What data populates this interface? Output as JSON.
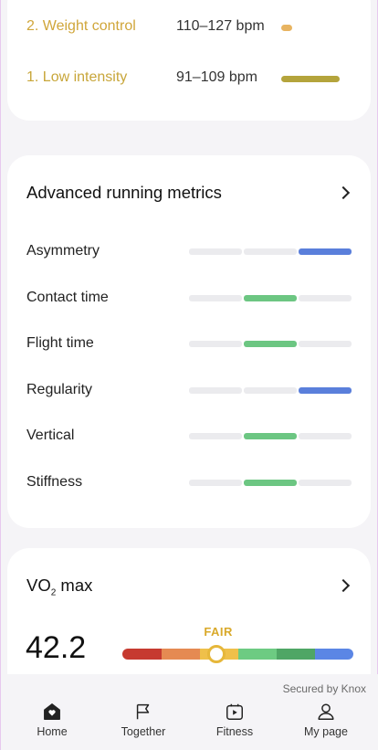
{
  "heart_rate_zones": [
    {
      "label": "2. Weight control",
      "bpm": "110–127 bpm",
      "color": "#d0a63a",
      "bar_color": "#e0b15c",
      "time_fraction": 0.03
    },
    {
      "label": "1. Low intensity",
      "bpm": "91–109 bpm",
      "color": "#c8a63a",
      "bar_color": "#b8a93a",
      "time_fraction": 0.2
    }
  ],
  "advanced_metrics": {
    "title": "Advanced running metrics",
    "items": [
      {
        "label": "Asymmetry",
        "level_segment": 2,
        "color": "#5a7fdb"
      },
      {
        "label": "Contact time",
        "level_segment": 1,
        "color": "#6cc682"
      },
      {
        "label": "Flight time",
        "level_segment": 1,
        "color": "#6cc682"
      },
      {
        "label": "Regularity",
        "level_segment": 2,
        "color": "#5a7fdb"
      },
      {
        "label": "Vertical",
        "level_segment": 1,
        "color": "#6cc682"
      },
      {
        "label": "Stiffness",
        "level_segment": 1,
        "color": "#6cc682"
      }
    ]
  },
  "vo2max": {
    "title_main": "VO",
    "title_sub": "2",
    "title_suffix": " max",
    "value": "42.2",
    "level": "FAIR",
    "level_position": 0.41,
    "gauge_colors": [
      "#c63a30",
      "#e58a52",
      "#efc04a",
      "#6dcb82",
      "#4fa665",
      "#5b86e5"
    ]
  },
  "footer": {
    "secured_text": "Secured by Knox"
  },
  "nav": [
    {
      "label": "Home",
      "icon": "home-heart-icon",
      "active": true
    },
    {
      "label": "Together",
      "icon": "flag-icon",
      "active": false
    },
    {
      "label": "Fitness",
      "icon": "fitness-play-icon",
      "active": false
    },
    {
      "label": "My page",
      "icon": "person-icon",
      "active": false
    }
  ]
}
